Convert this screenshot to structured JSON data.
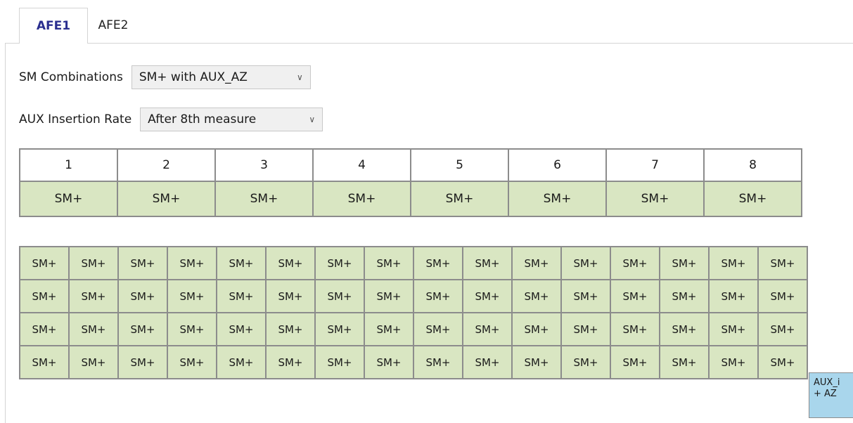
{
  "tabs": [
    {
      "label": "AFE1",
      "active": true
    },
    {
      "label": "AFE2",
      "active": false
    }
  ],
  "controls": {
    "sm_combinations": {
      "label": "SM Combinations",
      "value": "SM+ with AUX_AZ"
    },
    "aux_insertion_rate": {
      "label": "AUX Insertion Rate",
      "value": "After 8th measure"
    }
  },
  "measure_table": {
    "headers": [
      "1",
      "2",
      "3",
      "4",
      "5",
      "6",
      "7",
      "8"
    ],
    "row": [
      "SM+",
      "SM+",
      "SM+",
      "SM+",
      "SM+",
      "SM+",
      "SM+",
      "SM+"
    ]
  },
  "sequence_grid": {
    "rows": [
      [
        "SM+",
        "SM+",
        "SM+",
        "SM+",
        "SM+",
        "SM+",
        "SM+",
        "SM+",
        "SM+",
        "SM+",
        "SM+",
        "SM+",
        "SM+",
        "SM+",
        "SM+",
        "SM+"
      ],
      [
        "SM+",
        "SM+",
        "SM+",
        "SM+",
        "SM+",
        "SM+",
        "SM+",
        "SM+",
        "SM+",
        "SM+",
        "SM+",
        "SM+",
        "SM+",
        "SM+",
        "SM+",
        "SM+"
      ],
      [
        "SM+",
        "SM+",
        "SM+",
        "SM+",
        "SM+",
        "SM+",
        "SM+",
        "SM+",
        "SM+",
        "SM+",
        "SM+",
        "SM+",
        "SM+",
        "SM+",
        "SM+",
        "SM+"
      ],
      [
        "SM+",
        "SM+",
        "SM+",
        "SM+",
        "SM+",
        "SM+",
        "SM+",
        "SM+",
        "SM+",
        "SM+",
        "SM+",
        "SM+",
        "SM+",
        "SM+",
        "SM+",
        "SM+"
      ]
    ],
    "aux_cell": {
      "line1": "AUX_i",
      "line2": "+ AZ"
    }
  },
  "colors": {
    "cell_green": "#d9e6c2",
    "aux_blue": "#a9d6ec",
    "tab_active": "#2b2f8f"
  }
}
